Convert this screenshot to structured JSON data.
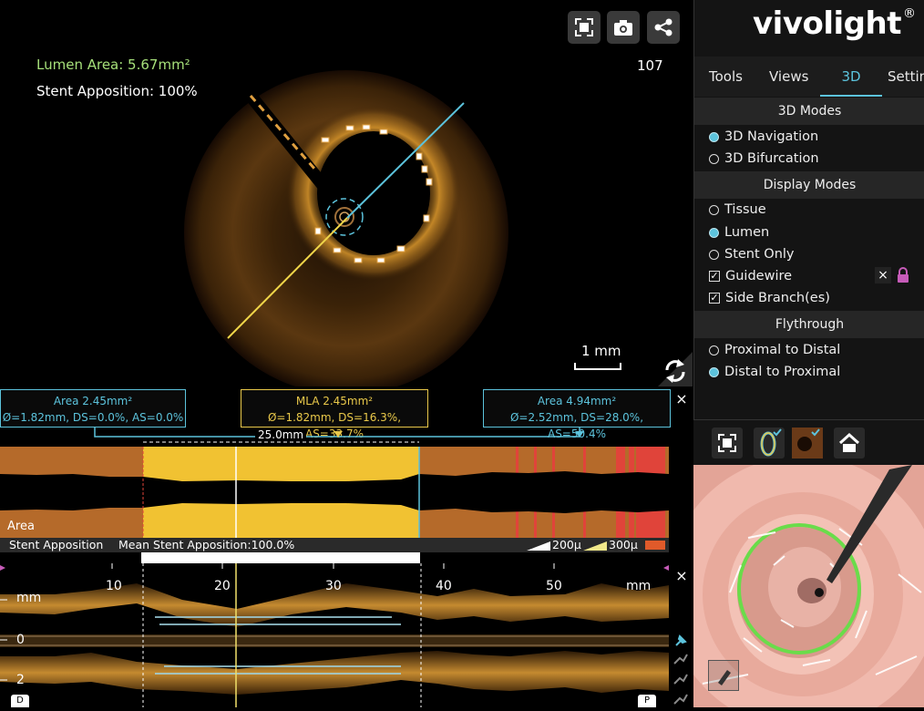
{
  "oct": {
    "lumen_area": "Lumen Area: 5.67mm²",
    "stent_apposition": "Stent Apposition: 100%",
    "frame_number": "107",
    "scale_label": "1 mm"
  },
  "top_toolbar": {
    "icons": [
      "fullscreen-icon",
      "camera-icon",
      "share-icon"
    ]
  },
  "brand": {
    "logo": "vivolight",
    "trademark": "®"
  },
  "tabs": [
    {
      "label": "Tools",
      "active": false
    },
    {
      "label": "Views",
      "active": false
    },
    {
      "label": "3D",
      "active": true
    },
    {
      "label": "Settin",
      "active": false
    }
  ],
  "modes_3d": {
    "header": "3D Modes",
    "options": [
      {
        "label": "3D Navigation",
        "selected": true
      },
      {
        "label": "3D Bifurcation",
        "selected": false
      }
    ]
  },
  "display_modes": {
    "header": "Display Modes",
    "radios": [
      {
        "label": "Tissue",
        "selected": false
      },
      {
        "label": "Lumen",
        "selected": true
      },
      {
        "label": "Stent Only",
        "selected": false
      }
    ],
    "checks": [
      {
        "label": "Guidewire",
        "checked": true
      },
      {
        "label": "Side Branch(es)",
        "checked": true
      }
    ],
    "guidewire_close": "×"
  },
  "flythrough": {
    "header": "Flythrough",
    "options": [
      {
        "label": "Proximal to Distal",
        "selected": false
      },
      {
        "label": "Distal to Proximal",
        "selected": true
      }
    ]
  },
  "info_boxes": {
    "left": {
      "line1": "Area 2.45mm²",
      "line2": "Ø=1.82mm, DS=0.0%, AS=0.0%"
    },
    "mla": {
      "line1": "MLA 2.45mm²",
      "line2": "Ø=1.82mm, DS=16.3%, AS=33.7%"
    },
    "right": {
      "line1": "Area 4.94mm²",
      "line2": "Ø=2.52mm, DS=28.0%, AS=50.4%"
    },
    "length": "25.0mm",
    "close": "×"
  },
  "area_graph": {
    "label": "Area"
  },
  "stent_bar": {
    "label": "Stent Apposition",
    "mean": "Mean Stent Apposition:100.0%",
    "legend_1": "200μ",
    "legend_2": "300μ"
  },
  "longitudinal": {
    "ticks": [
      "10",
      "20",
      "30",
      "40",
      "50"
    ],
    "unit": "mm",
    "y_labels": [
      "mm",
      "0",
      "2"
    ],
    "left_marker": "D",
    "right_marker": "P",
    "close": "×"
  },
  "colors": {
    "accent": "#5cc3dc",
    "mla": "#e9c84a",
    "area_fill": "#b56a2a",
    "lumen_green": "#a6e07a",
    "malapposition": "#e0443a"
  }
}
